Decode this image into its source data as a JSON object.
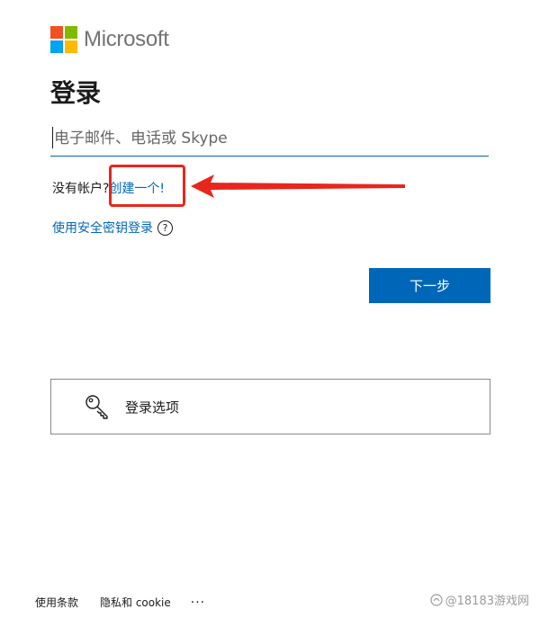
{
  "brand": {
    "name": "Microsoft",
    "logo_colors": [
      "#f25022",
      "#7fba00",
      "#00a4ef",
      "#ffb900"
    ]
  },
  "page": {
    "title": "登录"
  },
  "email": {
    "placeholder": "电子邮件、电话或 Skype",
    "value": ""
  },
  "account": {
    "no_account_text": "没有帐户?",
    "create_link": "创建一个!"
  },
  "security_key": {
    "label": "使用安全密钥登录",
    "help_icon": "?"
  },
  "actions": {
    "next_label": "下一步"
  },
  "signin_options": {
    "label": "登录选项",
    "icon": "key-icon"
  },
  "footer": {
    "terms": "使用条款",
    "privacy": "隐私和 cookie",
    "more": "···"
  },
  "watermark": {
    "text": "@18183游戏网"
  },
  "colors": {
    "accent": "#0067b8",
    "annotation": "#e8261c"
  }
}
